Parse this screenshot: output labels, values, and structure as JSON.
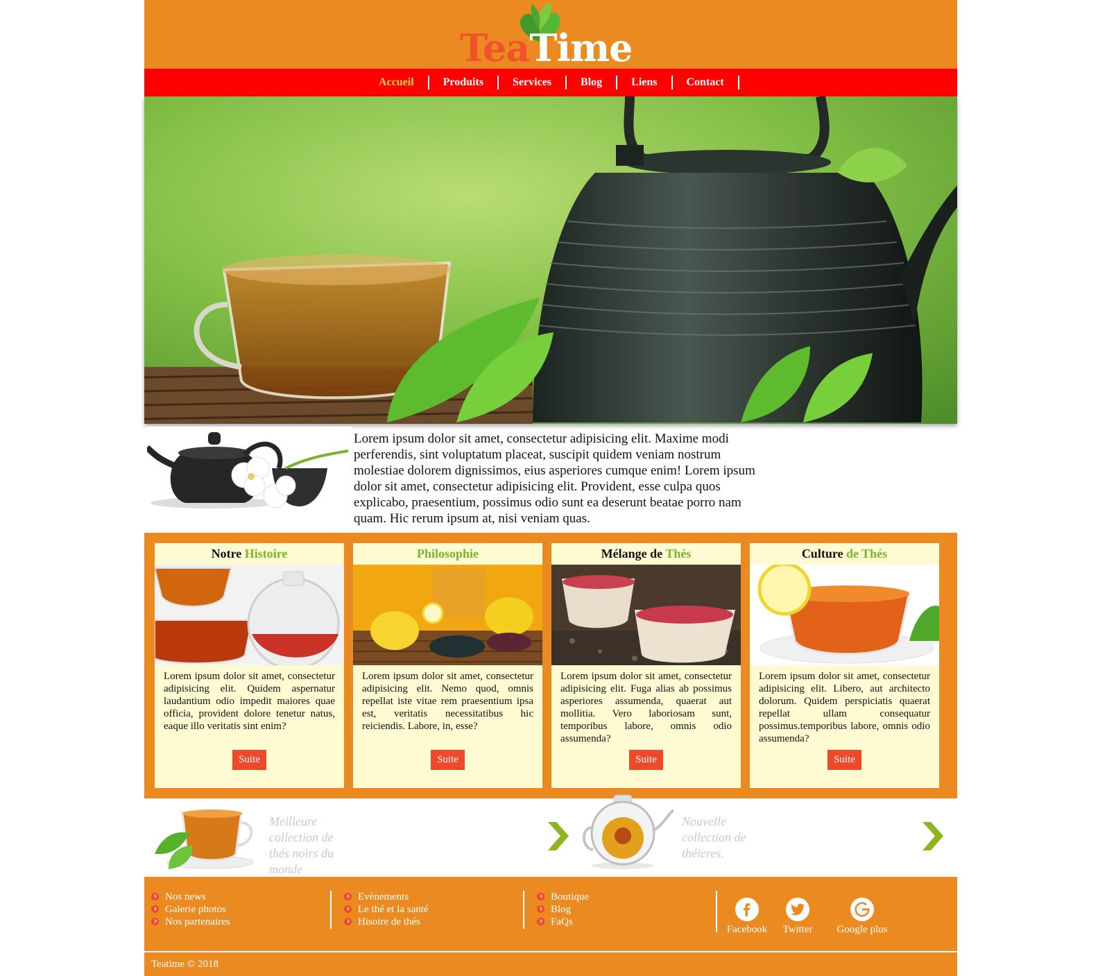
{
  "brand": {
    "logo_tea": "Tea",
    "logo_time": "Time"
  },
  "nav": {
    "items": [
      {
        "label": "Accueil",
        "active": true
      },
      {
        "label": "Produits",
        "active": false
      },
      {
        "label": "Services",
        "active": false
      },
      {
        "label": "Blog",
        "active": false
      },
      {
        "label": "Liens",
        "active": false
      },
      {
        "label": "Contact",
        "active": false
      }
    ]
  },
  "intro": {
    "text": "Lorem ipsum dolor sit amet, consectetur adipisicing elit. Maxime modi perferendis, sint voluptatum placeat, suscipit quidem veniam nostrum molestiae dolorem dignissimos, eius asperiores cumque enim! Lorem ipsum dolor sit amet, consectetur adipisicing elit. Provident, esse culpa quos explicabo, praesentium, possimus odio sunt ea deserunt beatae porro nam quam. Hic rerum ipsum at, nisi veniam quas."
  },
  "cards": [
    {
      "title_a": "Notre ",
      "title_b": "Histoire",
      "text": "Lorem ipsum dolor sit amet, consectetur adipisicing elit. Quidem aspernatur laudantium odio impedit maiores quae officia, provident dolore tenetur natus, eaque illo veritatis sint enim?",
      "button": "Suite"
    },
    {
      "title_a": "",
      "title_b": "Philosophie",
      "text": "Lorem ipsum dolor sit amet, consectetur adipisicing elit. Nemo quod, omnis repellat iste vitae rem praesentium ipsa est, veritatis necessitatibus hic reiciendis. Labore, in, esse?",
      "button": "Suite"
    },
    {
      "title_a": "Mélange de ",
      "title_b": "Thés",
      "text": "Lorem ipsum dolor sit amet, consectetur adipisicing elit. Fuga alias ab possimus asperiores assumenda, quaerat aut mollitia. Vero laboriosam sunt, temporibus labore, omnis odio assumenda?",
      "button": "Suite"
    },
    {
      "title_a": "Culture ",
      "title_b": "de Thés",
      "text": "Lorem ipsum dolor sit amet, consectetur adipisicing elit. Libero, aut architecto dolorum. Quidem perspiciatis quaerat repellat ullam consequatur possimus.temporibus labore, omnis odio assumenda?",
      "button": "Suite"
    }
  ],
  "promos": [
    {
      "text": "Meilleure collection de thés noirs du monde"
    },
    {
      "text": "Nouvelle collection de théieres."
    }
  ],
  "footer": {
    "col1": [
      "Nos news",
      "Galerie photos",
      "Nos partenaires"
    ],
    "col2": [
      "Evènements",
      "Le thé et la santé",
      "Hisoire de thés"
    ],
    "col3": [
      "Boutique",
      "Blog",
      "FaQs"
    ],
    "social": [
      {
        "label": "Facebook",
        "icon": "facebook-icon"
      },
      {
        "label": "Twitter",
        "icon": "twitter-icon"
      },
      {
        "label": "Google plus",
        "icon": "google-plus-icon"
      }
    ],
    "copyright": "Teatime © 2018"
  },
  "colors": {
    "orange": "#ec8a22",
    "nav_red": "#ff0000",
    "active_yellow": "#ffd43a",
    "accent_green": "#7bb32e",
    "button_red": "#f0482a",
    "card_bg": "#fefad1"
  }
}
